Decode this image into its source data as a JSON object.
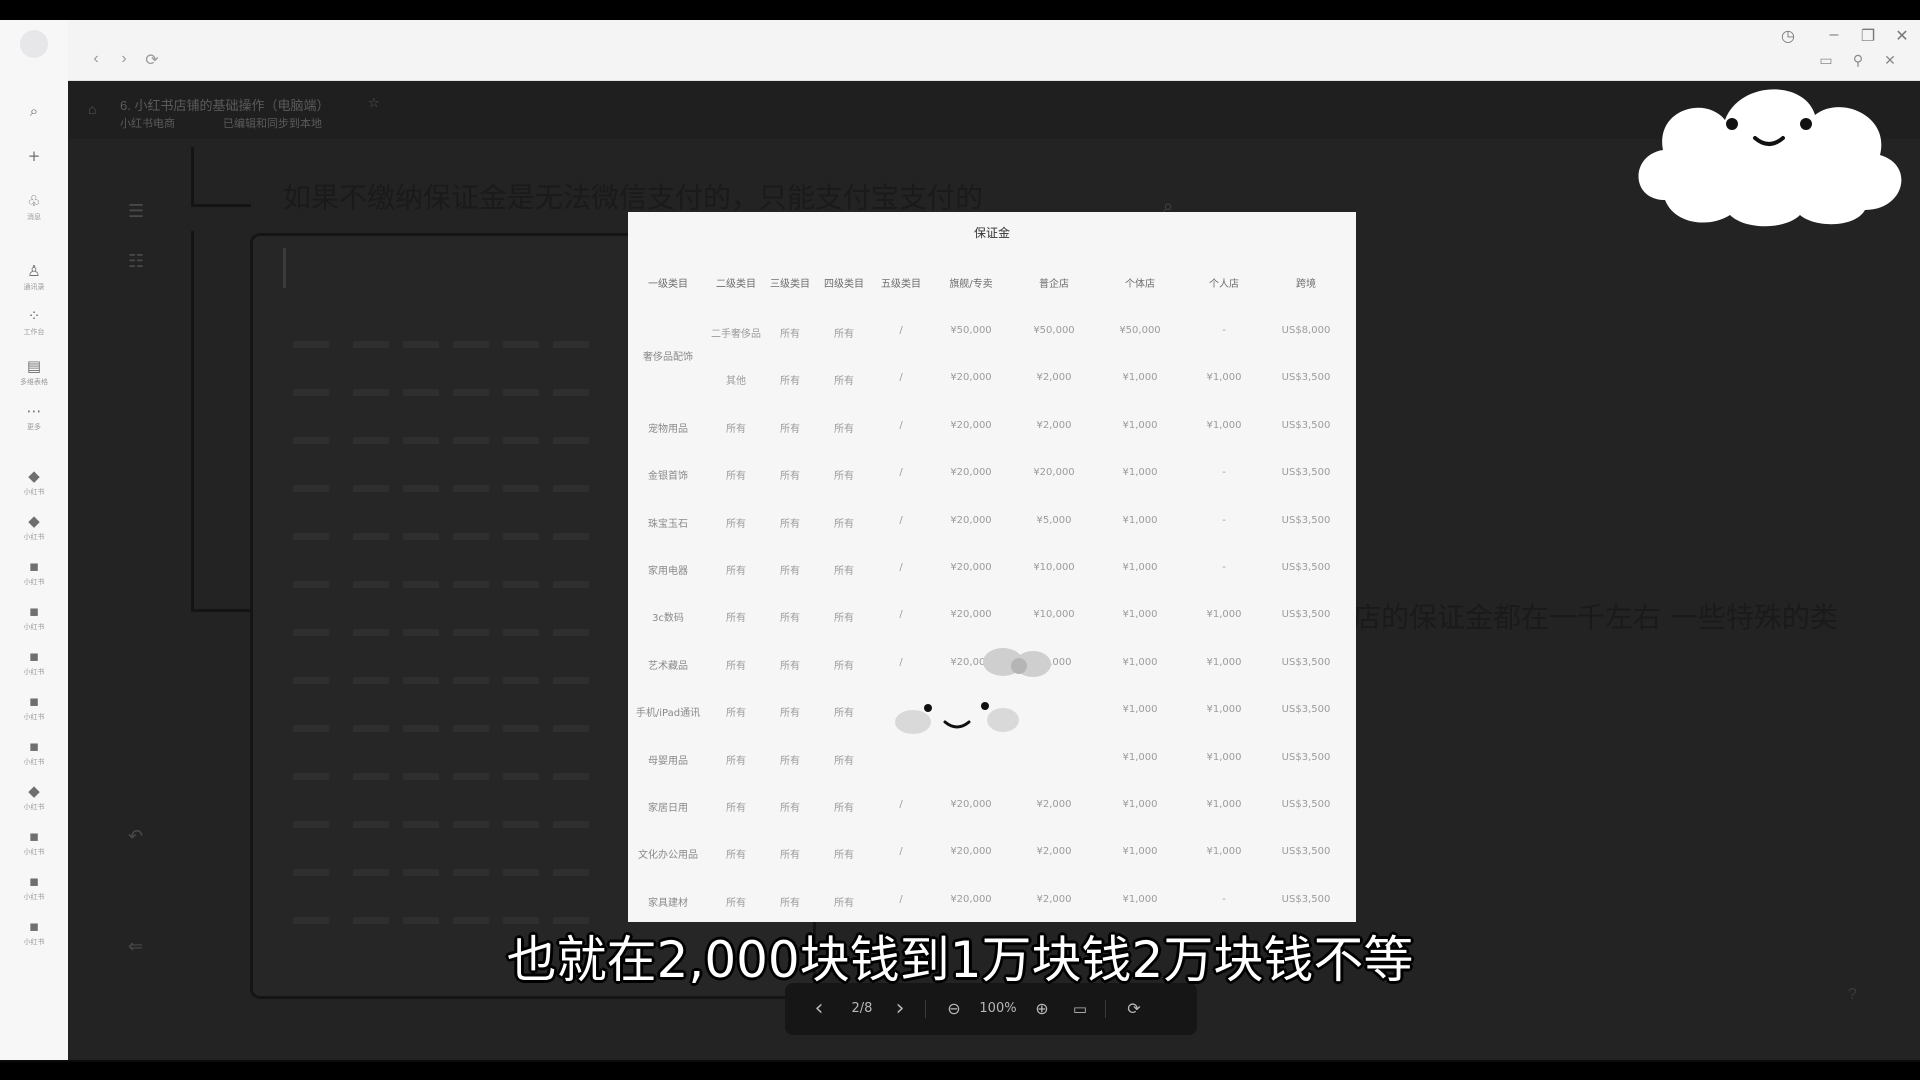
{
  "window": {
    "controls": {
      "history_icon": "clock-icon",
      "minimize": "–",
      "maximize": "❐",
      "close": "✕"
    }
  },
  "sidebar": {
    "items": [
      {
        "icon": "search-icon",
        "glyph": "⌕",
        "label": ""
      },
      {
        "icon": "plus-icon",
        "glyph": "+",
        "label": ""
      },
      {
        "icon": "people-icon",
        "glyph": "♧",
        "label": "消息"
      },
      {
        "icon": "contacts-icon",
        "glyph": "♙",
        "label": "通讯录"
      },
      {
        "icon": "apps-icon",
        "glyph": "⁘",
        "label": "工作台"
      },
      {
        "icon": "doc-icon",
        "glyph": "▤",
        "label": "多维表格"
      },
      {
        "icon": "more-icon",
        "glyph": "⋯",
        "label": "更多"
      },
      {
        "icon": "app-icon",
        "glyph": "◆",
        "label": "小红书"
      },
      {
        "icon": "app-icon",
        "glyph": "◆",
        "label": "小红书"
      },
      {
        "icon": "app-icon",
        "glyph": "▪",
        "label": "小红书"
      },
      {
        "icon": "app-icon",
        "glyph": "▪",
        "label": "小红书"
      },
      {
        "icon": "app-icon",
        "glyph": "▪",
        "label": "小红书"
      },
      {
        "icon": "app-icon",
        "glyph": "▪",
        "label": "小红书"
      },
      {
        "icon": "app-icon",
        "glyph": "▪",
        "label": "小红书"
      },
      {
        "icon": "app-icon",
        "glyph": "◆",
        "label": "小红书"
      },
      {
        "icon": "app-icon",
        "glyph": "▪",
        "label": "小红书"
      },
      {
        "icon": "app-icon",
        "glyph": "▪",
        "label": "小红书"
      },
      {
        "icon": "app-icon",
        "glyph": "▪",
        "label": "小红书"
      }
    ]
  },
  "document": {
    "breadcrumb": "6. 小红书店铺的基础操作（电脑端）",
    "sub_breadcrumb_1": "小红书电商",
    "sub_breadcrumb_2": "已编辑和同步到本地",
    "heading": "如果不缴纳保证金是无法微信支付的，只能支付宝支付的",
    "side_text": "店的保证金都在一千左右 一些特殊的类"
  },
  "viewer": {
    "title": "保证金",
    "columns": [
      "一级类目",
      "二级类目",
      "三级类目",
      "四级类目",
      "五级类目",
      "旗舰/专卖",
      "普企店",
      "个体店",
      "个人店",
      "跨境"
    ],
    "rows": [
      {
        "c1": "奢侈品配饰",
        "c2": "二手奢侈品",
        "c3": "所有",
        "c4": "所有",
        "c5": "/",
        "c6": "¥50,000",
        "c7": "¥50,000",
        "c8": "¥50,000",
        "c9": "-",
        "c10": "US$8,000"
      },
      {
        "c1": "",
        "c2": "其他",
        "c3": "所有",
        "c4": "所有",
        "c5": "/",
        "c6": "¥20,000",
        "c7": "¥2,000",
        "c8": "¥1,000",
        "c9": "¥1,000",
        "c10": "US$3,500"
      },
      {
        "c1": "宠物用品",
        "c2": "所有",
        "c3": "所有",
        "c4": "所有",
        "c5": "/",
        "c6": "¥20,000",
        "c7": "¥2,000",
        "c8": "¥1,000",
        "c9": "¥1,000",
        "c10": "US$3,500"
      },
      {
        "c1": "金银首饰",
        "c2": "所有",
        "c3": "所有",
        "c4": "所有",
        "c5": "/",
        "c6": "¥20,000",
        "c7": "¥20,000",
        "c8": "¥1,000",
        "c9": "-",
        "c10": "US$3,500"
      },
      {
        "c1": "珠宝玉石",
        "c2": "所有",
        "c3": "所有",
        "c4": "所有",
        "c5": "/",
        "c6": "¥20,000",
        "c7": "¥5,000",
        "c8": "¥1,000",
        "c9": "-",
        "c10": "US$3,500"
      },
      {
        "c1": "家用电器",
        "c2": "所有",
        "c3": "所有",
        "c4": "所有",
        "c5": "/",
        "c6": "¥20,000",
        "c7": "¥10,000",
        "c8": "¥1,000",
        "c9": "-",
        "c10": "US$3,500"
      },
      {
        "c1": "3c数码",
        "c2": "所有",
        "c3": "所有",
        "c4": "所有",
        "c5": "/",
        "c6": "¥20,000",
        "c7": "¥10,000",
        "c8": "¥1,000",
        "c9": "¥1,000",
        "c10": "US$3,500"
      },
      {
        "c1": "艺术藏品",
        "c2": "所有",
        "c3": "所有",
        "c4": "所有",
        "c5": "/",
        "c6": "¥20,000",
        "c7": "¥2,000",
        "c8": "¥1,000",
        "c9": "¥1,000",
        "c10": "US$3,500"
      },
      {
        "c1": "手机/iPad通讯",
        "c2": "所有",
        "c3": "所有",
        "c4": "所有",
        "c5": "",
        "c6": "",
        "c7": "",
        "c8": "¥1,000",
        "c9": "¥1,000",
        "c10": "US$3,500"
      },
      {
        "c1": "母婴用品",
        "c2": "所有",
        "c3": "所有",
        "c4": "所有",
        "c5": "",
        "c6": "",
        "c7": "",
        "c8": "¥1,000",
        "c9": "¥1,000",
        "c10": "US$3,500"
      },
      {
        "c1": "家居日用",
        "c2": "所有",
        "c3": "所有",
        "c4": "所有",
        "c5": "/",
        "c6": "¥20,000",
        "c7": "¥2,000",
        "c8": "¥1,000",
        "c9": "¥1,000",
        "c10": "US$3,500"
      },
      {
        "c1": "文化办公用品",
        "c2": "所有",
        "c3": "所有",
        "c4": "所有",
        "c5": "/",
        "c6": "¥20,000",
        "c7": "¥2,000",
        "c8": "¥1,000",
        "c9": "¥1,000",
        "c10": "US$3,500"
      },
      {
        "c1": "家具建材",
        "c2": "所有",
        "c3": "所有",
        "c4": "所有",
        "c5": "/",
        "c6": "¥20,000",
        "c7": "¥2,000",
        "c8": "¥1,000",
        "c9": "-",
        "c10": "US$3,500"
      }
    ],
    "toolbar": {
      "prev": "‹",
      "page": "2/8",
      "next": "›",
      "zoom_out": "⊖",
      "zoom": "100%",
      "zoom_in": "⊕",
      "fit": "▭",
      "rotate": "⟳"
    }
  },
  "subtitle": "也就在2,000块钱到1万块钱2万块钱不等"
}
